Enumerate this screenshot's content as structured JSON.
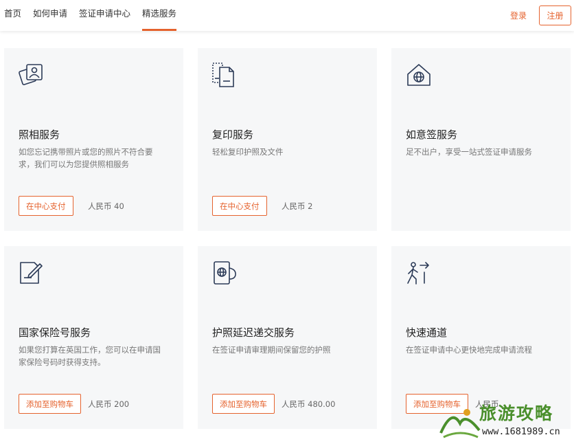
{
  "nav": {
    "items": [
      {
        "label": "首页"
      },
      {
        "label": "如何申请"
      },
      {
        "label": "签证申请中心"
      },
      {
        "label": "精选服务"
      }
    ],
    "login_label": "登录",
    "register_label": "注册"
  },
  "cards": [
    {
      "icon": "photo-icon",
      "title": "照相服务",
      "desc": "如您忘记携带照片或您的照片不符合要求，我们可以为您提供照相服务",
      "action": "在中心支付",
      "price": "人民币 40"
    },
    {
      "icon": "copy-document-icon",
      "title": "复印服务",
      "desc": "轻松复印护照及文件",
      "action": "在中心支付",
      "price": "人民币 2"
    },
    {
      "icon": "home-globe-icon",
      "title": "如意签服务",
      "desc": "足不出户，享受一站式签证申请服务",
      "action": "",
      "price": ""
    },
    {
      "icon": "document-pen-icon",
      "title": "国家保险号服务",
      "desc": "如果您打算在英国工作，您可以在申请国家保险号码时获得支持。",
      "action": "添加至购物车",
      "price": "人民币 200"
    },
    {
      "icon": "passport-hand-icon",
      "title": "护照延迟递交服务",
      "desc": "在签证申请审理期间保留您的护照",
      "action": "添加至购物车",
      "price": "人民币 480.00"
    },
    {
      "icon": "walking-arrow-icon",
      "title": "快速通道",
      "desc": "在签证申请中心更快地完成申请流程",
      "action": "添加至购物车",
      "price": "人民币"
    }
  ],
  "watermark": {
    "title": "旅游攻略",
    "url": "www.1681989.cn",
    "logo": "mountain-logo-icon"
  },
  "colors": {
    "accent": "#e5622d",
    "card_bg": "#f6f7f8"
  }
}
